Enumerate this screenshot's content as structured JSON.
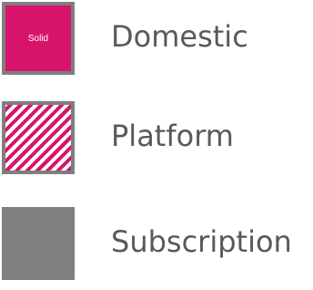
{
  "legend": {
    "items": [
      {
        "label": "Domestic",
        "swatch_text": "Solid",
        "pattern": "solid",
        "color": "#d6156a"
      },
      {
        "label": "Platform",
        "pattern": "diagonal-stripes",
        "color": "#d6156a"
      },
      {
        "label": "Subscription",
        "pattern": "solid",
        "color": "#7f7f7f"
      }
    ],
    "border_color": "#7f7f7f",
    "text_color": "#595959"
  }
}
